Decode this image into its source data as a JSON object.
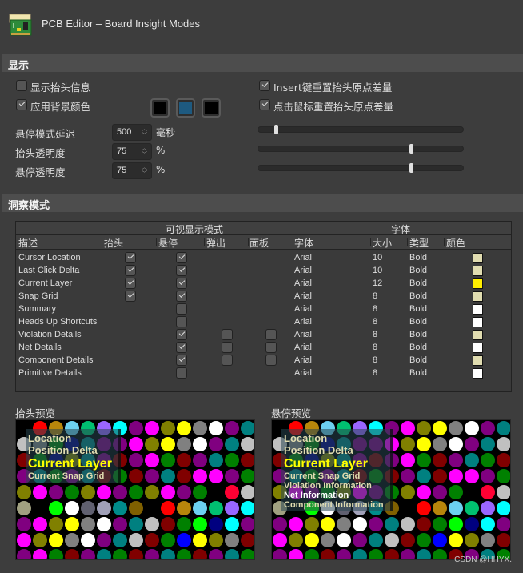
{
  "window": {
    "title": "PCB Editor – Board Insight Modes",
    "icon": "pcb-board-icon"
  },
  "display_section": {
    "header": "显示",
    "show_heads_up": {
      "label": "显示抬头信息",
      "checked": false
    },
    "use_background_color": {
      "label": "应用背景颜色",
      "checked": true
    },
    "background_colors": [
      "#000000",
      "#1e5a80",
      "#000000"
    ],
    "insert_reset": {
      "label": "Insert键重置抬头原点差量",
      "checked": true
    },
    "click_reset": {
      "label": "点击鼠标重置抬头原点差量",
      "checked": true
    },
    "hover_delay": {
      "label": "悬停模式延迟",
      "value": "500",
      "unit": "毫秒",
      "slider_fraction": 0.08
    },
    "heads_up_opacity": {
      "label": "抬头透明度",
      "value": "75",
      "unit": "%",
      "slider_fraction": 0.75
    },
    "hover_opacity": {
      "label": "悬停透明度",
      "value": "75",
      "unit": "%",
      "slider_fraction": 0.75
    }
  },
  "insight_section": {
    "header": "洞察模式",
    "group_headers": {
      "visible_modes": "可视显示模式",
      "font": "字体"
    },
    "columns": [
      "描述",
      "抬头",
      "悬停",
      "弹出",
      "面板",
      "字体",
      "大小",
      "类型",
      "颜色"
    ],
    "rows": [
      {
        "desc": "Cursor Location",
        "headsup": true,
        "hover": true,
        "popup": null,
        "panel": null,
        "font": "Arial",
        "size": "10",
        "style": "Bold",
        "color": "#e0dcb0"
      },
      {
        "desc": "Last Click Delta",
        "headsup": true,
        "hover": true,
        "popup": null,
        "panel": null,
        "font": "Arial",
        "size": "10",
        "style": "Bold",
        "color": "#e0dcb0"
      },
      {
        "desc": "Current Layer",
        "headsup": true,
        "hover": true,
        "popup": null,
        "panel": null,
        "font": "Arial",
        "size": "12",
        "style": "Bold",
        "color": "#ffee00"
      },
      {
        "desc": "Snap Grid",
        "headsup": true,
        "hover": true,
        "popup": null,
        "panel": null,
        "font": "Arial",
        "size": "8",
        "style": "Bold",
        "color": "#e0dcb0"
      },
      {
        "desc": "Summary",
        "headsup": null,
        "hover": false,
        "popup": null,
        "panel": null,
        "font": "Arial",
        "size": "8",
        "style": "Bold",
        "color": "#ffffff"
      },
      {
        "desc": "Heads Up Shortcuts",
        "headsup": null,
        "hover": false,
        "popup": null,
        "panel": null,
        "font": "Arial",
        "size": "8",
        "style": "Bold",
        "color": "#ffffff"
      },
      {
        "desc": "Violation Details",
        "headsup": null,
        "hover": true,
        "popup": false,
        "panel": false,
        "font": "Arial",
        "size": "8",
        "style": "Bold",
        "color": "#e0dcb0"
      },
      {
        "desc": "Net Details",
        "headsup": null,
        "hover": true,
        "popup": false,
        "panel": false,
        "font": "Arial",
        "size": "8",
        "style": "Bold",
        "color": "#ffffff"
      },
      {
        "desc": "Component Details",
        "headsup": null,
        "hover": true,
        "popup": false,
        "panel": false,
        "font": "Arial",
        "size": "8",
        "style": "Bold",
        "color": "#e0dcb0"
      },
      {
        "desc": "Primitive Details",
        "headsup": null,
        "hover": false,
        "popup": null,
        "panel": null,
        "font": "Arial",
        "size": "8",
        "style": "Bold",
        "color": "#ffffff"
      }
    ]
  },
  "previews": {
    "headsup": {
      "label": "抬头预览",
      "lines": [
        "Location",
        "Position Delta",
        "Current Layer",
        "Current Snap Grid"
      ]
    },
    "hover": {
      "label": "悬停预览",
      "lines": [
        "Location",
        "Position Delta",
        "Current Layer",
        "Current Snap Grid",
        "Violation Information",
        "Net Information",
        "Component Information"
      ]
    },
    "dot_grid": [
      [
        "#000000",
        "#ff0000",
        "#b8860b",
        "#6cd0f0",
        "#00c070",
        "#9966ff",
        "#00ffff",
        "#800080",
        "#ff00ff",
        "#808000",
        "#ffff00",
        "#808080",
        "#ffffff",
        "#800080",
        "#008080"
      ],
      [
        "#c0c0c0",
        "#808080",
        "#008000",
        "#000080",
        "#008080",
        "#800080",
        "#800080",
        "#ff00ff",
        "#808000",
        "#ffff00",
        "#808080",
        "#ffffff",
        "#800080",
        "#008080",
        "#c0c0c0"
      ],
      [
        "#800000",
        "#008000",
        "#000080",
        "#808000",
        "#008080",
        "#800080",
        "#800000",
        "#800080",
        "#ff00ff",
        "#008000",
        "#800000",
        "#800080",
        "#008080",
        "#008000",
        "#800000"
      ],
      [
        "#800080",
        "#008080",
        "#008000",
        "#800080",
        "#008080",
        "#800000",
        "#008000",
        "#800000",
        "#800080",
        "#008080",
        "#800000",
        "#ff00ff",
        "#ff00ff",
        "#800080",
        "#008000"
      ],
      [
        "#808000",
        "#ff00ff",
        "#800080",
        "#008000",
        "#808000",
        "#ff00ff",
        "#800080",
        "#008000",
        "#808000",
        "#ff00ff",
        "#800080",
        "#008000",
        "#000000",
        "#ff0033",
        "#c0c0c0"
      ],
      [
        "#a0a080",
        "#000000",
        "#00ff00",
        "#ffffff",
        "#606070",
        "#a0a0b8",
        "#008b8b",
        "#806000",
        "#000000",
        "#ff0000",
        "#b8860b",
        "#6cd0f0",
        "#00c070",
        "#9966ff",
        "#00ffff"
      ],
      [
        "#800080",
        "#ff00ff",
        "#808000",
        "#ffff00",
        "#808080",
        "#ffffff",
        "#800080",
        "#008080",
        "#c0c0c0",
        "#800000",
        "#008000",
        "#00ff00",
        "#000080",
        "#00ffff",
        "#800080"
      ],
      [
        "#ff00ff",
        "#808000",
        "#ffff00",
        "#808080",
        "#ffffff",
        "#800080",
        "#008080",
        "#c0c0c0",
        "#800000",
        "#008000",
        "#0000ff",
        "#ffff00",
        "#808000",
        "#808080",
        "#800000"
      ],
      [
        "#800080",
        "#ff00ff",
        "#008000",
        "#800000",
        "#800080",
        "#008080",
        "#008000",
        "#800000",
        "#800080",
        "#008080",
        "#008000",
        "#800000",
        "#800080",
        "#008080",
        "#008000"
      ]
    ]
  },
  "watermark": "CSDN @HHYX."
}
